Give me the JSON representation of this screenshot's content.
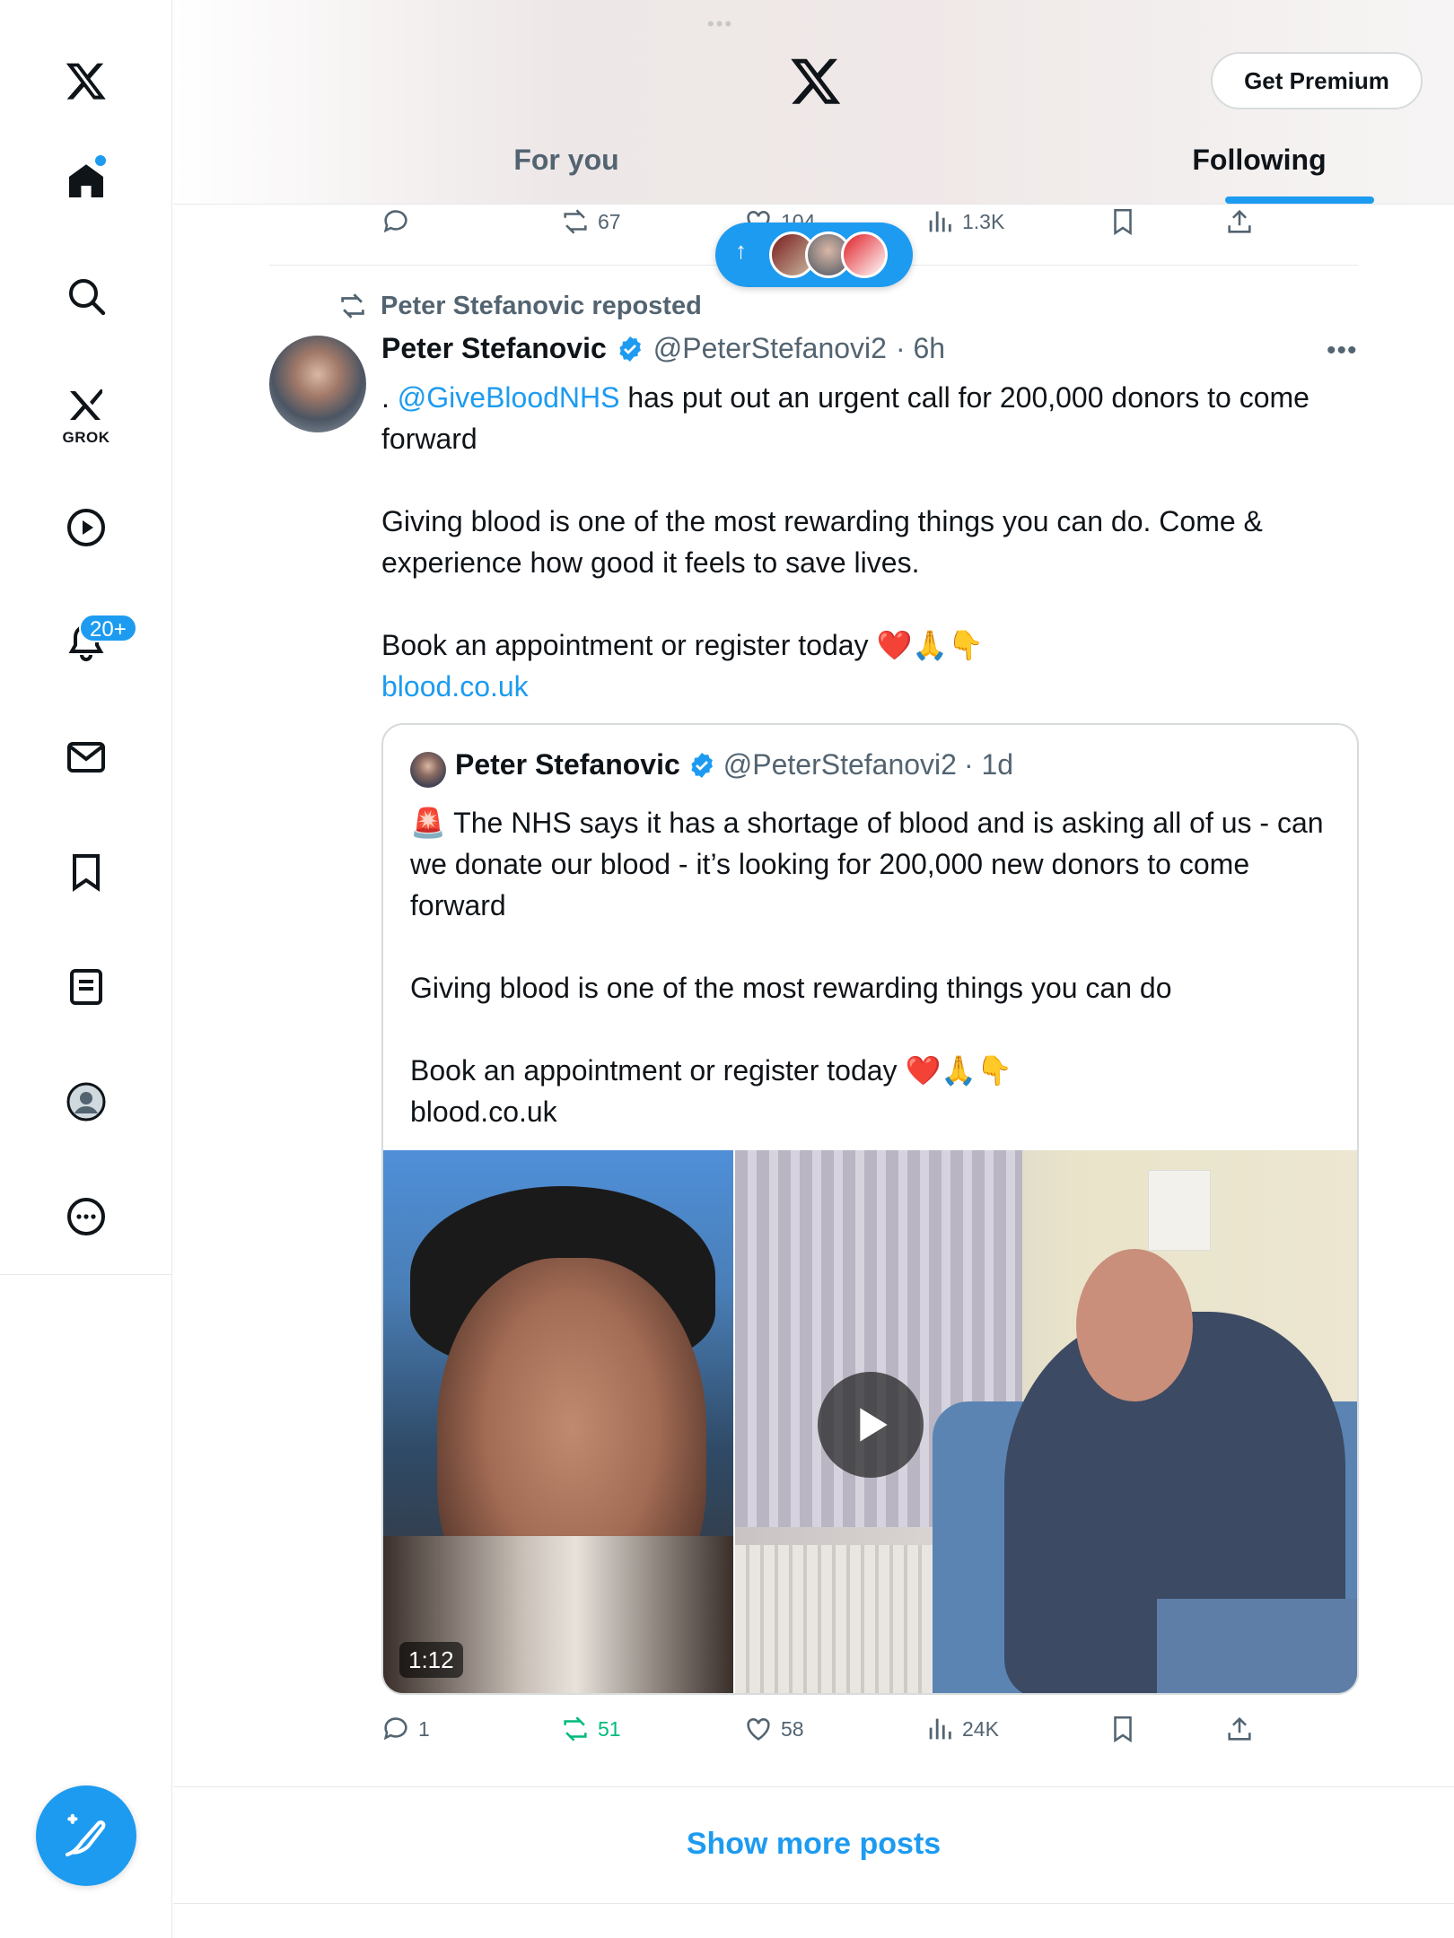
{
  "sidebar": {
    "items": [
      {
        "name": "x-logo-icon"
      },
      {
        "name": "home-icon"
      },
      {
        "name": "search-icon"
      },
      {
        "name": "grok-icon",
        "label": "GROK"
      },
      {
        "name": "video-icon"
      },
      {
        "name": "notifications-icon",
        "badge": "20+"
      },
      {
        "name": "messages-icon"
      },
      {
        "name": "bookmarks-icon"
      },
      {
        "name": "lists-icon"
      },
      {
        "name": "profile-icon"
      },
      {
        "name": "more-icon"
      }
    ],
    "compose_icon": "compose-post-icon"
  },
  "header": {
    "premium_label": "Get Premium",
    "tabs": [
      {
        "label": "For you",
        "active": false
      },
      {
        "label": "Following",
        "active": true
      }
    ]
  },
  "prev_tweet_actions": {
    "retweets": "67",
    "likes": "104",
    "views": "1.3K"
  },
  "new_posts_pill": {
    "arrow": "↑"
  },
  "tweet": {
    "repost_label": "Peter Stefanovic reposted",
    "name": "Peter Stefanovic",
    "handle": "@PeterStefanovi2",
    "time": "· 6h",
    "text_parts": {
      "prefix": ". ",
      "mention": "@GiveBloodNHS",
      "line1_rest": " has put out an urgent call for 200,000 donors to come forward",
      "line2": "Giving blood is one of the most rewarding things you can do. Come & experience how good it feels to save lives.",
      "line3": "Book an appointment or register today ❤️🙏👇",
      "link": "blood.co.uk"
    },
    "quote": {
      "name": "Peter Stefanovic",
      "handle": "@PeterStefanovi2",
      "time": "· 1d",
      "line1": "🚨 The NHS says it has a shortage of blood and is asking all of us - can we donate our blood - it’s looking for 200,000 new donors to come forward",
      "line2": "Giving blood is one of the most rewarding things you can do",
      "line3": "Book an appointment or register today ❤️🙏👇",
      "line4": "blood.co.uk",
      "video_duration": "1:12"
    },
    "actions": {
      "replies": "1",
      "retweets": "51",
      "likes": "58",
      "views": "24K"
    }
  },
  "show_more": "Show more posts",
  "colors": {
    "accent": "#1d9bf0",
    "retweet_green": "#00ba7c",
    "muted_text": "#536471"
  }
}
